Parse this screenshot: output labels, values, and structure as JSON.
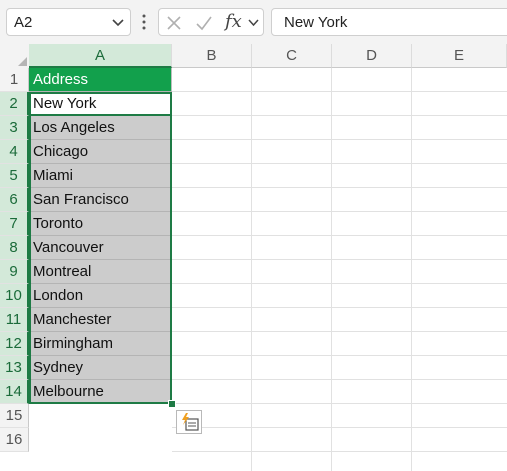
{
  "formula_bar": {
    "name_box": "A2",
    "fx_label": "fx",
    "formula_value": "New York",
    "icons": [
      "chevron-down-icon",
      "kebab-icon",
      "cancel-x-icon",
      "enter-check-icon",
      "chevron-down-icon"
    ]
  },
  "columns": [
    "A",
    "B",
    "C",
    "D",
    "E"
  ],
  "rows": [
    "1",
    "2",
    "3",
    "4",
    "5",
    "6",
    "7",
    "8",
    "9",
    "10",
    "11",
    "12",
    "13",
    "14",
    "15",
    "16"
  ],
  "cells": {
    "header": "Address",
    "values": [
      "New York",
      "Los Angeles",
      "Chicago",
      "Miami",
      "San Francisco",
      "Toronto",
      "Vancouver",
      "Montreal",
      "London",
      "Manchester",
      "Birmingham",
      "Sydney",
      "Melbourne"
    ]
  },
  "selection": {
    "active_cell": "A2",
    "range": "A2:A14"
  },
  "colors": {
    "header_fill": "#12a04c",
    "selected_fill": "#cccccc",
    "selection_border": "#1e7b45",
    "header_highlight": "#d3e9d9"
  },
  "flash_fill_icon": "flash-fill-options-icon"
}
